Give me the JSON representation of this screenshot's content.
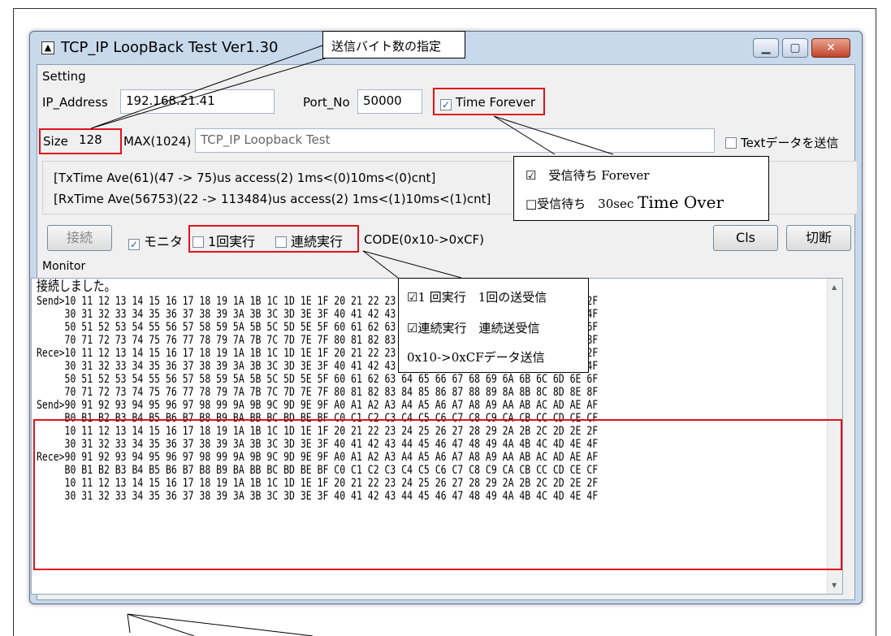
{
  "window": {
    "title": "TCP_IP LoopBack Test Ver1.30",
    "icon": "app-icon",
    "controls": [
      "minimize-icon",
      "maximize-icon",
      "close-icon"
    ]
  },
  "setting": {
    "group_label": "Setting",
    "ip_label": "IP_Address",
    "ip_value": "192.168.21.41",
    "port_label": "Port_No",
    "port_value": "50000",
    "time_forever_label": "Time Forever",
    "time_forever_checked": true,
    "size_label": "Size",
    "size_value": "128",
    "max_label": "MAX(1024)",
    "text_value": "TCP_IP Loopback Test",
    "text_send_label": "Textデータを送信",
    "text_send_checked": false
  },
  "status": {
    "tx_line": "[TxTime Ave(61)(47 -> 75)us access(2) 1ms<(0)10ms<(0)cnt]",
    "rx_line": "[RxTime Ave(56753)(22 -> 113484)us access(2) 1ms<(1)10ms<(1)cnt]"
  },
  "controls": {
    "connect_label": "接続",
    "monitor_label": "モニタ",
    "monitor_checked": true,
    "once_label": "1回実行",
    "once_checked": false,
    "continuous_label": "連続実行",
    "continuous_checked": false,
    "code_label": "CODE(0x10->0xCF)",
    "cls_label": "Cls",
    "disconnect_label": "切断"
  },
  "monitor": {
    "group_label": "Monitor",
    "lines": [
      "接続しました。",
      "Send>10 11 12 13 14 15 16 17 18 19 1A 1B 1C 1D 1E 1F 20 21 22 23 24 25 26 27 28 29 2A 2B 2C 2D 2E 2F",
      "     30 31 32 33 34 35 36 37 38 39 3A 3B 3C 3D 3E 3F 40 41 42 43 44 45 46 47 48 49 4A 4B 4C 4D 4E 4F",
      "     50 51 52 53 54 55 56 57 58 59 5A 5B 5C 5D 5E 5F 60 61 62 63 64 65 66 67 68 69 6A 6B 6C 6D 6E 6F",
      "     70 71 72 73 74 75 76 77 78 79 7A 7B 7C 7D 7E 7F 80 81 82 83 84 85 86 87 88 89 8A 8B 8C 8D 8E 8F",
      "Rece>10 11 12 13 14 15 16 17 18 19 1A 1B 1C 1D 1E 1F 20 21 22 23 24 25 26 27 28 29 2A 2B 2C 2D 2E 2F",
      "     30 31 32 33 34 35 36 37 38 39 3A 3B 3C 3D 3E 3F 40 41 42 43 44 45 46 47 48 49 4A 4B 4C 4D 4E 4F",
      "     50 51 52 53 54 55 56 57 58 59 5A 5B 5C 5D 5E 5F 60 61 62 63 64 65 66 67 68 69 6A 6B 6C 6D 6E 6F",
      "     70 71 72 73 74 75 76 77 78 79 7A 7B 7C 7D 7E 7F 80 81 82 83 84 85 86 87 88 89 8A 8B 8C 8D 8E 8F",
      "Send>90 91 92 93 94 95 96 97 98 99 9A 9B 9C 9D 9E 9F A0 A1 A2 A3 A4 A5 A6 A7 A8 A9 AA AB AC AD AE AF",
      "     B0 B1 B2 B3 B4 B5 B6 B7 B8 B9 BA BB BC BD BE BF C0 C1 C2 C3 C4 C5 C6 C7 C8 C9 CA CB CC CD CE CF",
      "     10 11 12 13 14 15 16 17 18 19 1A 1B 1C 1D 1E 1F 20 21 22 23 24 25 26 27 28 29 2A 2B 2C 2D 2E 2F",
      "     30 31 32 33 34 35 36 37 38 39 3A 3B 3C 3D 3E 3F 40 41 42 43 44 45 46 47 48 49 4A 4B 4C 4D 4E 4F",
      "Rece>90 91 92 93 94 95 96 97 98 99 9A 9B 9C 9D 9E 9F A0 A1 A2 A3 A4 A5 A6 A7 A8 A9 AA AB AC AD AE AF",
      "     B0 B1 B2 B3 B4 B5 B6 B7 B8 B9 BA BB BC BD BE BF C0 C1 C2 C3 C4 C5 C6 C7 C8 C9 CA CB CC CD CE CF",
      "     10 11 12 13 14 15 16 17 18 19 1A 1B 1C 1D 1E 1F 20 21 22 23 24 25 26 27 28 29 2A 2B 2C 2D 2E 2F",
      "     30 31 32 33 34 35 36 37 38 39 3A 3B 3C 3D 3E 3F 40 41 42 43 44 45 46 47 48 49 4A 4B 4C 4D 4E 4F"
    ]
  },
  "annotations": {
    "size_note": "送信バイト数の指定",
    "forever_note_1": "☑　受信待ち Forever",
    "forever_note_2a": "□受信待ち　30sec ",
    "forever_note_2b": "Time Over",
    "run_note_1": "☑1 回実行　1回の送受信",
    "run_note_2": "☑連続実行　連続送受信",
    "run_note_3": "0x10->0xCFデータ送信"
  },
  "colors": {
    "highlight": "#e0131a",
    "window_frame": "#c9d9ec",
    "close_button": "#c2432a"
  }
}
